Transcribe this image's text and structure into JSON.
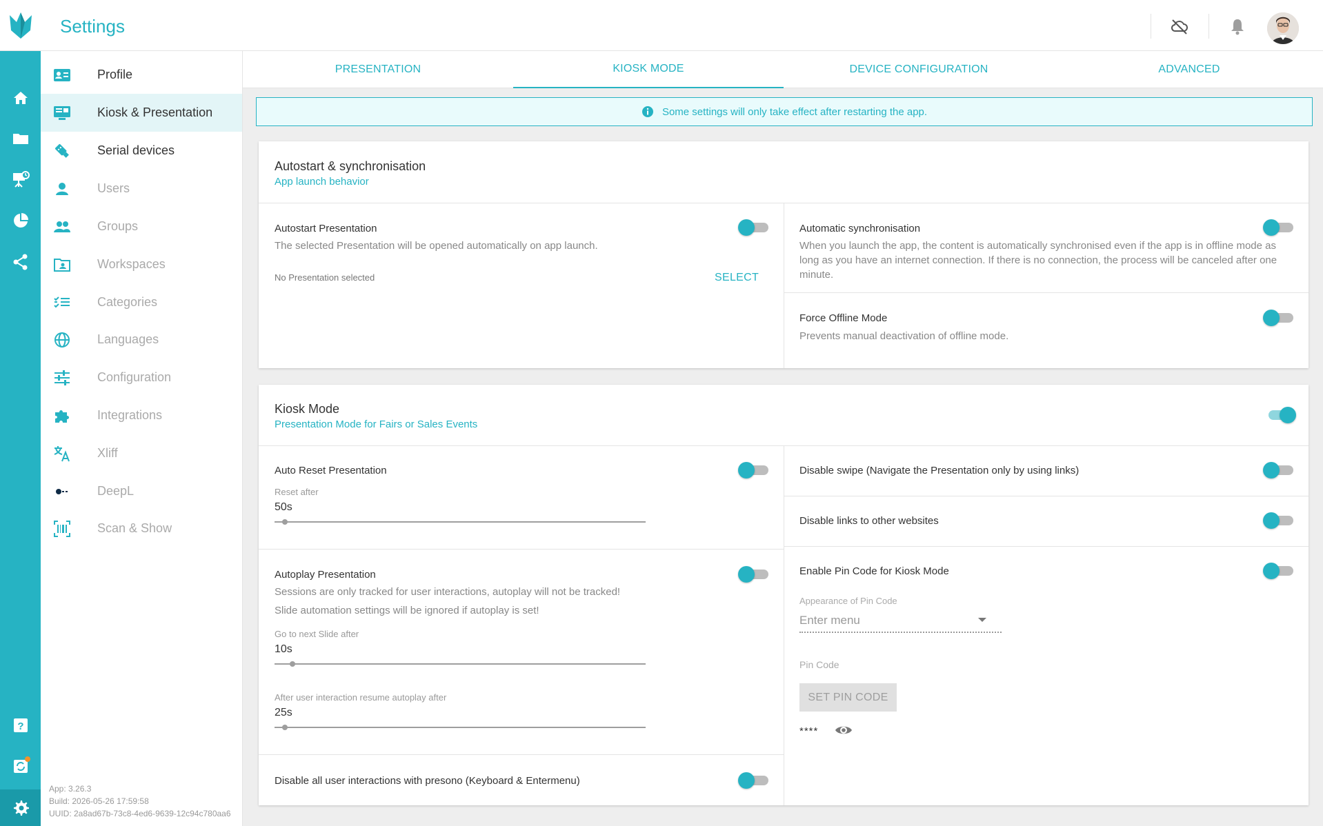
{
  "header": {
    "title": "Settings"
  },
  "rail": {
    "items": [
      "home-icon",
      "folder-icon",
      "presentation-icon",
      "chart-pie-icon",
      "share-icon",
      "help-icon",
      "sync-icon",
      "settings-icon"
    ],
    "notification_dot_color": "#f0932b"
  },
  "sidebar": {
    "items": [
      {
        "label": "Profile",
        "icon": "profile-card-icon"
      },
      {
        "label": "Kiosk & Presentation",
        "icon": "monitor-icon"
      },
      {
        "label": "Serial devices",
        "icon": "usb-icon"
      },
      {
        "label": "Users",
        "icon": "person-icon"
      },
      {
        "label": "Groups",
        "icon": "people-icon"
      },
      {
        "label": "Workspaces",
        "icon": "workspace-icon"
      },
      {
        "label": "Categories",
        "icon": "checklist-icon"
      },
      {
        "label": "Languages",
        "icon": "globe-icon"
      },
      {
        "label": "Configuration",
        "icon": "sliders-icon"
      },
      {
        "label": "Integrations",
        "icon": "puzzle-icon"
      },
      {
        "label": "Xliff",
        "icon": "translate-icon"
      },
      {
        "label": "DeepL",
        "icon": "deepl-icon"
      },
      {
        "label": "Scan & Show",
        "icon": "barcode-scan-icon"
      }
    ],
    "active_index": 1
  },
  "build": {
    "app": "App: 3.26.3",
    "build": "Build: 2026-05-26 17:59:58",
    "uuid": "UUID: 2a8ad67b-73c8-4ed6-9639-12c94c780aa6"
  },
  "tabs": [
    {
      "label": "PRESENTATION"
    },
    {
      "label": "KIOSK MODE"
    },
    {
      "label": "DEVICE CONFIGURATION"
    },
    {
      "label": "ADVANCED"
    }
  ],
  "active_tab": "KIOSK MODE",
  "banner": {
    "text": "Some settings will only take effect after restarting the app."
  },
  "autostart": {
    "title": "Autostart & synchronisation",
    "subtitle": "App launch behavior",
    "autostart_presentation": {
      "label": "Autostart Presentation",
      "description": "The selected Presentation will be opened automatically on app launch.",
      "selected_text": "No Presentation selected",
      "select_label": "SELECT",
      "enabled": false
    },
    "automatic_sync": {
      "label": "Automatic synchronisation",
      "description": "When you launch the app, the content is automatically synchronised even if the app is in offline mode as long as you have an internet connection. If there is no connection, the process will be canceled after one minute.",
      "enabled": false
    },
    "force_offline": {
      "label": "Force Offline Mode",
      "description": "Prevents manual deactivation of offline mode.",
      "enabled": false
    }
  },
  "kiosk": {
    "title": "Kiosk Mode",
    "subtitle": "Presentation Mode for Fairs or Sales Events",
    "enabled": true,
    "auto_reset": {
      "label": "Auto Reset Presentation",
      "enabled": false,
      "reset_after_label": "Reset after",
      "reset_after_value": "50s",
      "reset_after_level": 0.02
    },
    "autoplay": {
      "label": "Autoplay Presentation",
      "enabled": false,
      "description_1": "Sessions are only tracked for user interactions, autoplay will not be tracked!",
      "description_2": "Slide automation settings will be ignored if autoplay is set!",
      "next_slide_label": "Go to next Slide after",
      "next_slide_value": "10s",
      "next_slide_level": 0.04,
      "resume_label": "After user interaction resume autoplay after",
      "resume_value": "25s",
      "resume_level": 0.02
    },
    "disable_interactions": {
      "label": "Disable all user interactions with presono (Keyboard & Entermenu)",
      "enabled": false
    },
    "disable_swipe": {
      "label": "Disable swipe (Navigate the Presentation only by using links)",
      "enabled": false
    },
    "disable_links": {
      "label": "Disable links to other websites",
      "enabled": false
    },
    "pin_code": {
      "label": "Enable Pin Code for Kiosk Mode",
      "enabled": false,
      "appearance_label": "Appearance of Pin Code",
      "appearance_placeholder": "Enter menu",
      "pin_label": "Pin Code",
      "set_button": "SET PIN CODE",
      "masked_value": "****"
    }
  },
  "colors": {
    "accent": "#26b3c3",
    "rail_bg": "#26b3c3",
    "page_bg": "#eeeeee"
  }
}
